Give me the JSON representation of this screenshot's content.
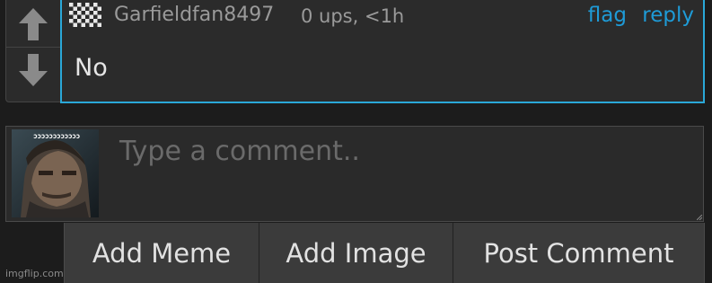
{
  "comment": {
    "username": "Garfieldfan8497",
    "meta": "0 ups, <1h",
    "flag_label": "flag",
    "reply_label": "reply",
    "text": "No"
  },
  "composer": {
    "placeholder": "Type a comment..",
    "avatar_caption": "ɔɔɔɔɔɔɔɔɔɔɔɔ"
  },
  "buttons": {
    "add_meme": "Add Meme",
    "add_image": "Add Image",
    "post_comment": "Post Comment"
  },
  "watermark": "imgflip.com",
  "colors": {
    "accent": "#1e9bd7",
    "focus_border": "#2aa8d8",
    "background": "#1c1c1c",
    "card": "#2b2b2b",
    "button": "#3b3b3b"
  },
  "icons": {
    "upvote": "arrow-up-icon",
    "downvote": "arrow-down-icon",
    "commenter_avatar": "checkerboard-avatar-icon"
  }
}
